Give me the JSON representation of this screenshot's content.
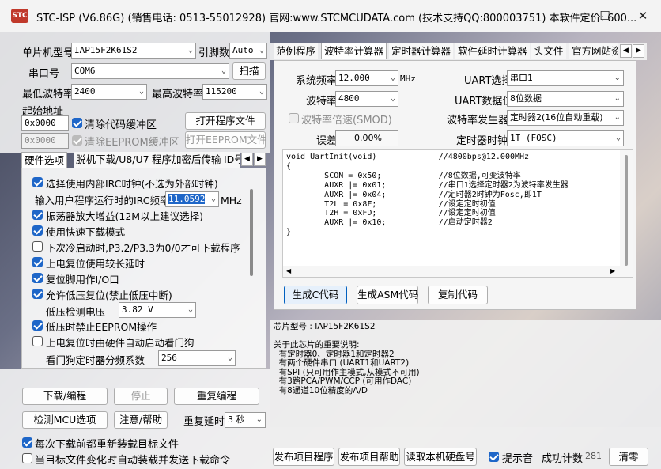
{
  "window": {
    "title": "STC-ISP (V6.86G) (销售电话: 0513-55012928) 官网:www.STCMCUDATA.com  (技术支持QQ:800003751) 本软件定价: 600...",
    "icon": "STC",
    "minimize": "—",
    "maximize": "☐",
    "close": "✕"
  },
  "left": {
    "mcu_label": "单片机型号",
    "mcu_value": "IAP15F2K61S2",
    "pin_label": "引脚数",
    "pin_value": "Auto",
    "port_label": "串口号",
    "port_value": "COM6",
    "scan": "扫描",
    "minbaud_label": "最低波特率",
    "minbaud_value": "2400",
    "maxbaud_label": "最高波特率",
    "maxbaud_value": "115200",
    "start_label": "起始地址",
    "addr1": "0x0000",
    "clear_code": "清除代码缓冲区",
    "open_prog": "打开程序文件",
    "addr2": "0x0000",
    "clear_eeprom": "清除EEPROM缓冲区",
    "open_eeprom": "打开EEPROM文件",
    "tabs": [
      "硬件选项",
      "脱机下载/U8/U7",
      "程序加密后传输",
      "ID号"
    ],
    "irc_input_label": "输入用户程序运行时的IRC频率",
    "irc_value": "11.0592",
    "irc_unit": "MHz",
    "opt_internal_irc": "选择使用内部IRC时钟(不选为外部时钟)",
    "opt_osc": "振荡器放大增益(12M以上建议选择)",
    "opt_fast": "使用快速下载模式",
    "opt_cold": "下次冷启动时,P3.2/P3.3为0/0才可下载程序",
    "opt_reset_long": "上电复位使用较长延时",
    "opt_reset_io": "复位脚用作I/O口",
    "opt_lvr": "允许低压复位(禁止低压中断)",
    "lv_label": "低压检测电压",
    "lv_value": "3.82 V",
    "opt_lv_eeprom": "低压时禁止EEPROM操作",
    "opt_wdt": "上电复位时由硬件自动启动看门狗",
    "wdt_label": "看门狗定时器分频系数",
    "wdt_value": "256",
    "download": "下载/编程",
    "stop": "停止",
    "reprogram": "重复编程",
    "detect": "检测MCU选项",
    "help": "注意/帮助",
    "delay_label": "重复延时",
    "delay_value": "3 秒",
    "reload_each": "每次下载前都重新装载目标文件",
    "auto_reload": "当目标文件变化时自动装载并发送下载命令"
  },
  "right": {
    "tabs": [
      "范例程序",
      "波特率计算器",
      "定时器计算器",
      "软件延时计算器",
      "头文件",
      "官方网站资"
    ],
    "sysfreq_label": "系统频率",
    "sysfreq_value": "12.000",
    "sysfreq_unit": "MHz",
    "uart_label": "UART选择",
    "uart_value": "串口1",
    "baud_label": "波特率",
    "baud_value": "4800",
    "bits_label": "UART数据位",
    "bits_value": "8位数据",
    "double_label": "波特率倍速(SMOD)",
    "gen_label": "波特率发生器",
    "gen_value": "定时器2(16位自动重载)",
    "err_label": "误差",
    "err_value": "0.00%",
    "clk_label": "定时器时钟",
    "clk_value": "1T  (FOSC)",
    "code": "void UartInit(void)\t\t//4800bps@12.000MHz\n{\n\tSCON = 0x50;\t\t//8位数据,可变波特率\n\tAUXR |= 0x01;\t\t//串口1选择定时器2为波特率发生器\n\tAUXR |= 0x04;\t\t//定时器2时钟为Fosc,即1T\n\tT2L = 0x8F;\t\t//设定定时初值\n\tT2H = 0xFD;\t\t//设定定时初值\n\tAUXR |= 0x10;\t\t//启动定时器2\n}",
    "gen_c": "生成C代码",
    "gen_asm": "生成ASM代码",
    "copy": "复制代码",
    "info": "芯片型号 : IAP15F2K61S2\n\n关于此芯片的重要说明:\n  有定时器0、定时器1和定时器2\n  有两个硬件串口 (UART1和UART2)\n  有SPI (只可用作主模式,从模式不可用)\n  有3路PCA/PWM/CCP (可用作DAC)\n  有8通道10位精度的A/D",
    "publish_prog": "发布项目程序",
    "publish_help": "发布项目帮助",
    "read_disk": "读取本机硬盘号",
    "beep": "提示音",
    "success_label": "成功计数",
    "success_value": "281",
    "clear": "清零"
  }
}
